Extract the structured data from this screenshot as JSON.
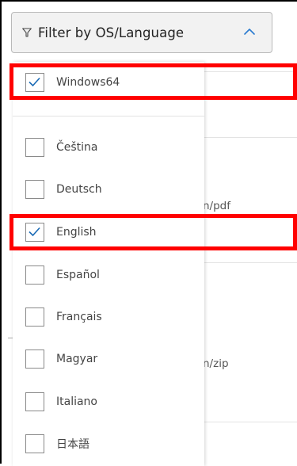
{
  "filter": {
    "button_label": "Filter by OS/Language",
    "filter_icon": "funnel-icon",
    "toggle_icon": "chevron-up-icon",
    "expanded": true
  },
  "options": [
    {
      "label": "Windows64",
      "checked": true
    },
    {
      "label": "Čeština",
      "checked": false
    },
    {
      "label": "Deutsch",
      "checked": false
    },
    {
      "label": "English",
      "checked": true
    },
    {
      "label": "Español",
      "checked": false
    },
    {
      "label": "Français",
      "checked": false
    },
    {
      "label": "Magyar",
      "checked": false
    },
    {
      "label": "Italiano",
      "checked": false
    },
    {
      "label": "日本語",
      "checked": false
    }
  ],
  "background": {
    "file_type_1": "n/pdf",
    "file_type_2": "n/zip"
  },
  "colors": {
    "accent": "#1a6ab5",
    "highlight": "#ff0000"
  }
}
